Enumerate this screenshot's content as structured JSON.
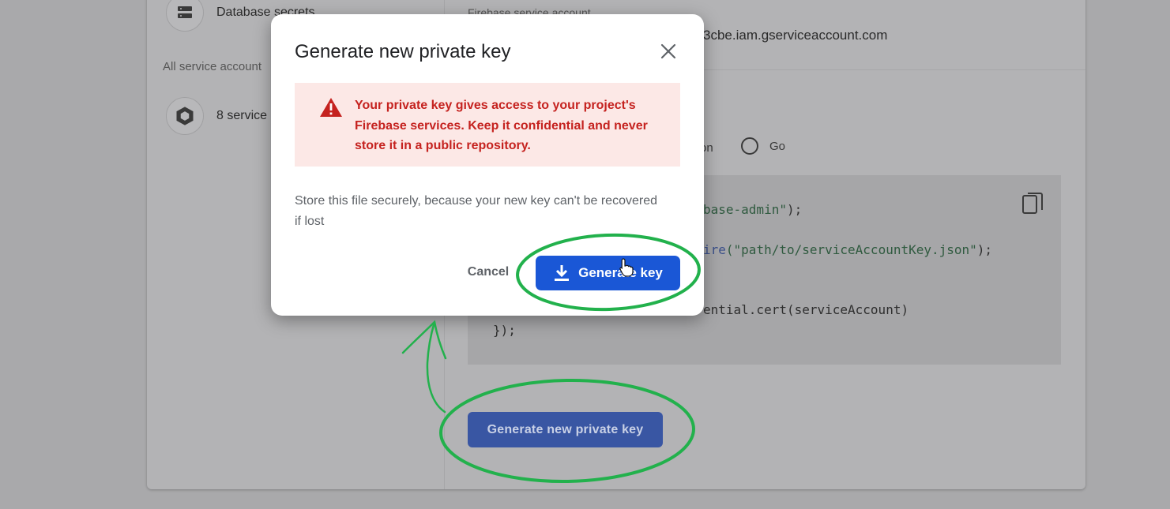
{
  "background": {
    "nav": [
      {
        "label": "Database secrets",
        "icon": "database-icon"
      },
      {
        "label": "8 service",
        "icon": "hexagon-icon"
      }
    ],
    "all_service_accounts_label": "All service account",
    "service_account_label": "Firebase service account",
    "service_account_email": "3cbe.iam.gserviceaccount.com",
    "radio_partial_label": "on",
    "radio_go_label": "Go",
    "code": {
      "line1_str": "base-admin\"",
      "line1_end": ");",
      "line2_fn": "ire",
      "line2_str": "(\"path/to/serviceAccountKey.json\"",
      "line2_end": ");",
      "line3": "ential.cert(serviceAccount)",
      "line4": "});"
    },
    "generate_button_label": "Generate new private key"
  },
  "modal": {
    "title": "Generate new private key",
    "warning": "Your private key gives access to your project's Firebase services. Keep it confidential and never store it in a public repository.",
    "body": "Store this file securely, because your new key can't be recovered if lost",
    "cancel_label": "Cancel",
    "generate_label": "Generate key"
  },
  "colors": {
    "primary": "#1a57d6",
    "warning_text": "#c5221f",
    "warning_bg": "#fce8e6",
    "annotation": "#22b14c"
  }
}
